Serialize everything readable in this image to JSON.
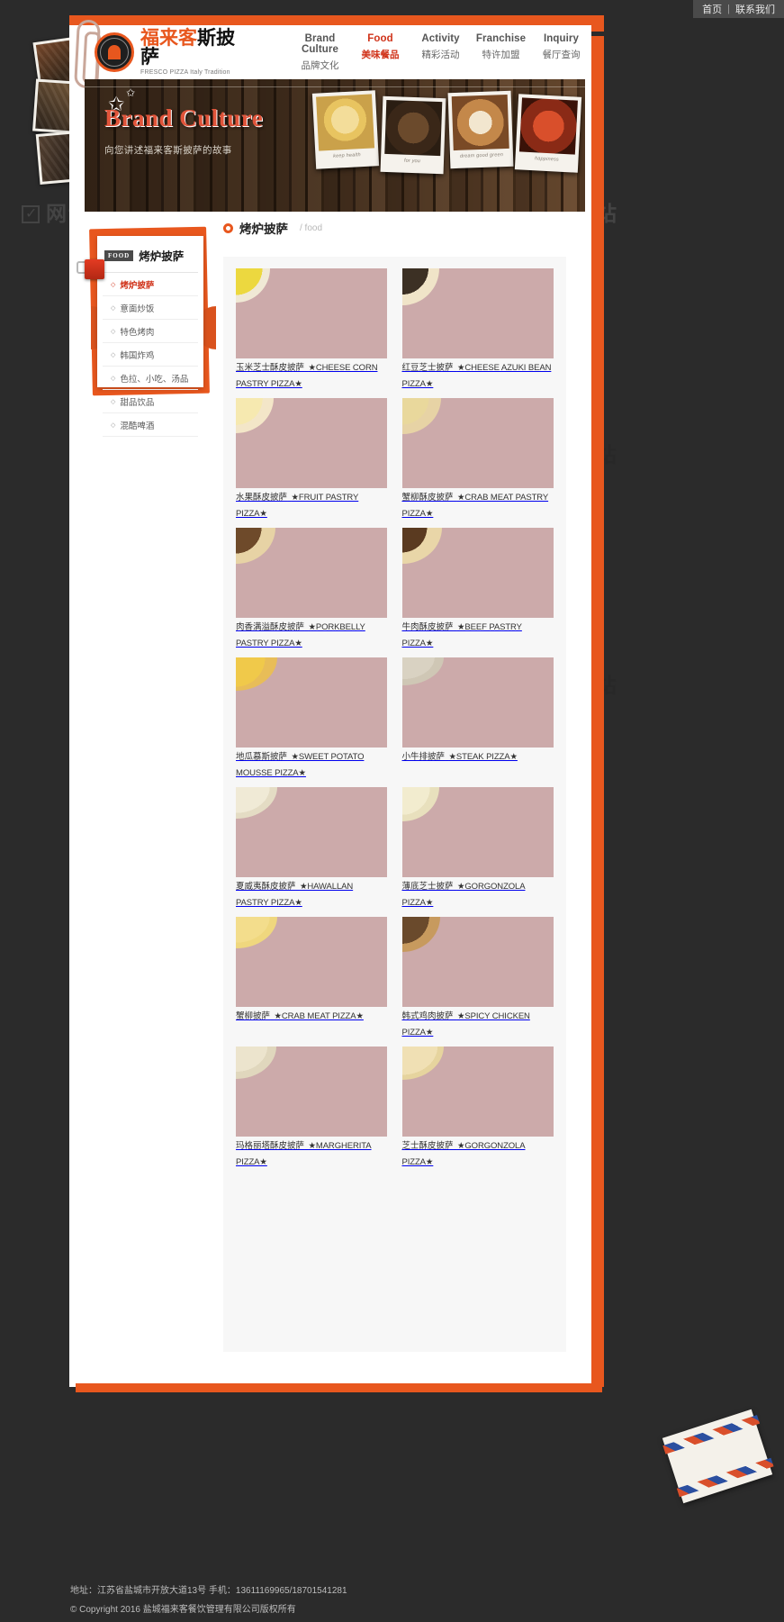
{
  "topbar": {
    "home": "首页",
    "separator": "|",
    "contact": "联系我们"
  },
  "brand": {
    "name_cn": "福来客斯披萨",
    "name_cn_highlight": "福来客",
    "name_cn_rest": "斯披萨",
    "name_en": "FRESCO PIZZA Italy Tradition",
    "logo_icon": "pizza-badge-icon"
  },
  "nav": [
    {
      "en": "Brand Culture",
      "cn": "品牌文化",
      "active": false
    },
    {
      "en": "Food",
      "cn": "美味餐品",
      "active": true
    },
    {
      "en": "Activity",
      "cn": "精彩活动",
      "active": false
    },
    {
      "en": "Franchise",
      "cn": "特许加盟",
      "active": false
    },
    {
      "en": "Inquiry",
      "cn": "餐厅查询",
      "active": false
    }
  ],
  "banner": {
    "title": "Brand Culture",
    "subtitle": "向您讲述福来客斯披萨的故事",
    "photos": [
      {
        "caption": "keep health"
      },
      {
        "caption": "for you"
      },
      {
        "caption": "dream good green"
      },
      {
        "caption": "happiness"
      }
    ]
  },
  "breadcrumb": {
    "title": "烤炉披萨",
    "path": "/ food"
  },
  "sidebar": {
    "chip": "FOOD",
    "title": "烤炉披萨",
    "items": [
      {
        "label": "烤炉披萨",
        "active": true
      },
      {
        "label": "意面炒饭",
        "active": false
      },
      {
        "label": "特色烤肉",
        "active": false
      },
      {
        "label": "韩国炸鸡",
        "active": false
      },
      {
        "label": "色拉、小吃、汤品",
        "active": false
      },
      {
        "label": "甜品饮品",
        "active": false
      },
      {
        "label": "混酷啤酒",
        "active": false
      }
    ]
  },
  "products": [
    {
      "name": "玉米芝士酥皮披萨",
      "en": "★CHEESE CORN PASTRY PIZZA★",
      "thumb": "t-wood",
      "pizza": "pz-corn"
    },
    {
      "name": "红豆芝士披萨",
      "en": "★CHEESE AZUKI BEAN PIZZA★",
      "thumb": "t-grey",
      "pizza": "pz-azuki"
    },
    {
      "name": "水果酥皮披萨",
      "en": "★FRUIT PASTRY PIZZA★",
      "thumb": "t-wood2",
      "pizza": "pz-fruit"
    },
    {
      "name": "蟹柳酥皮披萨",
      "en": "★CRAB MEAT PASTRY PIZZA★",
      "thumb": "t-wood2",
      "pizza": "pz-crabp"
    },
    {
      "name": "肉香满溢酥皮披萨",
      "en": "★PORKBELLY PASTRY PIZZA★",
      "thumb": "t-white",
      "pizza": "pz-pork"
    },
    {
      "name": "牛肉酥皮披萨",
      "en": "★BEEF PASTRY PIZZA★",
      "thumb": "t-white",
      "pizza": "pz-beef"
    },
    {
      "name": "地瓜慕斯披萨",
      "en": "★SWEET POTATO MOUSSE PIZZA★",
      "thumb": "t-wood",
      "pizza": "pz-sweet"
    },
    {
      "name": "小牛排披萨",
      "en": "★STEAK PIZZA★",
      "thumb": "t-dark",
      "pizza": "pz-steak"
    },
    {
      "name": "夏威夷酥皮披萨",
      "en": "★HAWALLAN PASTRY PIZZA★",
      "thumb": "t-dark",
      "pizza": "pz-hawai"
    },
    {
      "name": "薄底芝士披萨",
      "en": "★GORGONZOLA PIZZA★",
      "thumb": "t-dark",
      "pizza": "pz-gorg"
    },
    {
      "name": "蟹柳披萨",
      "en": "★CRAB MEAT PIZZA★",
      "thumb": "t-wood2",
      "pizza": "pz-crab"
    },
    {
      "name": "韩式鸡肉披萨",
      "en": "★SPICY CHICKEN PIZZA★",
      "thumb": "t-dark",
      "pizza": "pz-spicy"
    },
    {
      "name": "玛格丽塔酥皮披萨",
      "en": "★MARGHERITA PIZZA★",
      "thumb": "t-dark",
      "pizza": "pz-marg"
    },
    {
      "name": "芝士酥皮披萨",
      "en": "★GORGONZOLA PIZZA★",
      "thumb": "t-wood2",
      "pizza": "pz-cheese"
    }
  ],
  "footer": {
    "address_line": "地址：江苏省盐城市开放大道13号 手机：13611169965/18701541281",
    "copyright_line": "© Copyright 2016 盐城福来客餐饮管理有限公司版权所有"
  },
  "watermark": {
    "text": "网诚建站"
  },
  "colors": {
    "accent": "#e8571e",
    "active_red": "#d0331a",
    "dark_bg": "#2b2b2b"
  }
}
